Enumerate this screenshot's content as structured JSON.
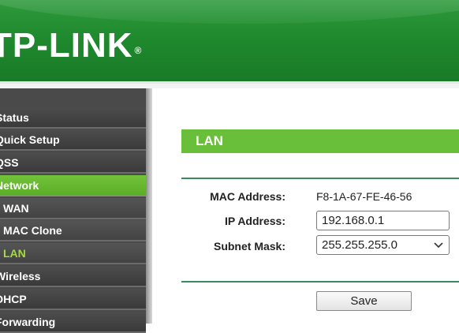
{
  "brand": {
    "logo_text": "TP-LINK",
    "registered_mark": "®"
  },
  "sidebar": {
    "items": [
      {
        "label": "Status"
      },
      {
        "label": "Quick Setup"
      },
      {
        "label": "QSS"
      },
      {
        "label": "Network",
        "state": "expanded"
      },
      {
        "label": "WAN"
      },
      {
        "label": "MAC Clone"
      },
      {
        "label": "LAN",
        "state": "current"
      },
      {
        "label": "Wireless"
      },
      {
        "label": "DHCP"
      },
      {
        "label": "Forwarding"
      }
    ]
  },
  "main": {
    "section_title": "LAN",
    "mac_label": "MAC Address:",
    "mac_value": "F8-1A-67-FE-46-56",
    "ip_label": "IP Address:",
    "ip_value": "192.168.0.1",
    "subnet_label": "Subnet Mask:",
    "subnet_value": "255.255.255.0",
    "save_label": "Save"
  },
  "colors": {
    "header_green": "#1f8a2e",
    "accent_green": "#6abf3a",
    "current_item_text": "#a6d84a",
    "sidebar_bg": "#4a4a4a"
  },
  "icons": {
    "subnet_dropdown": "chevron-down-icon"
  }
}
